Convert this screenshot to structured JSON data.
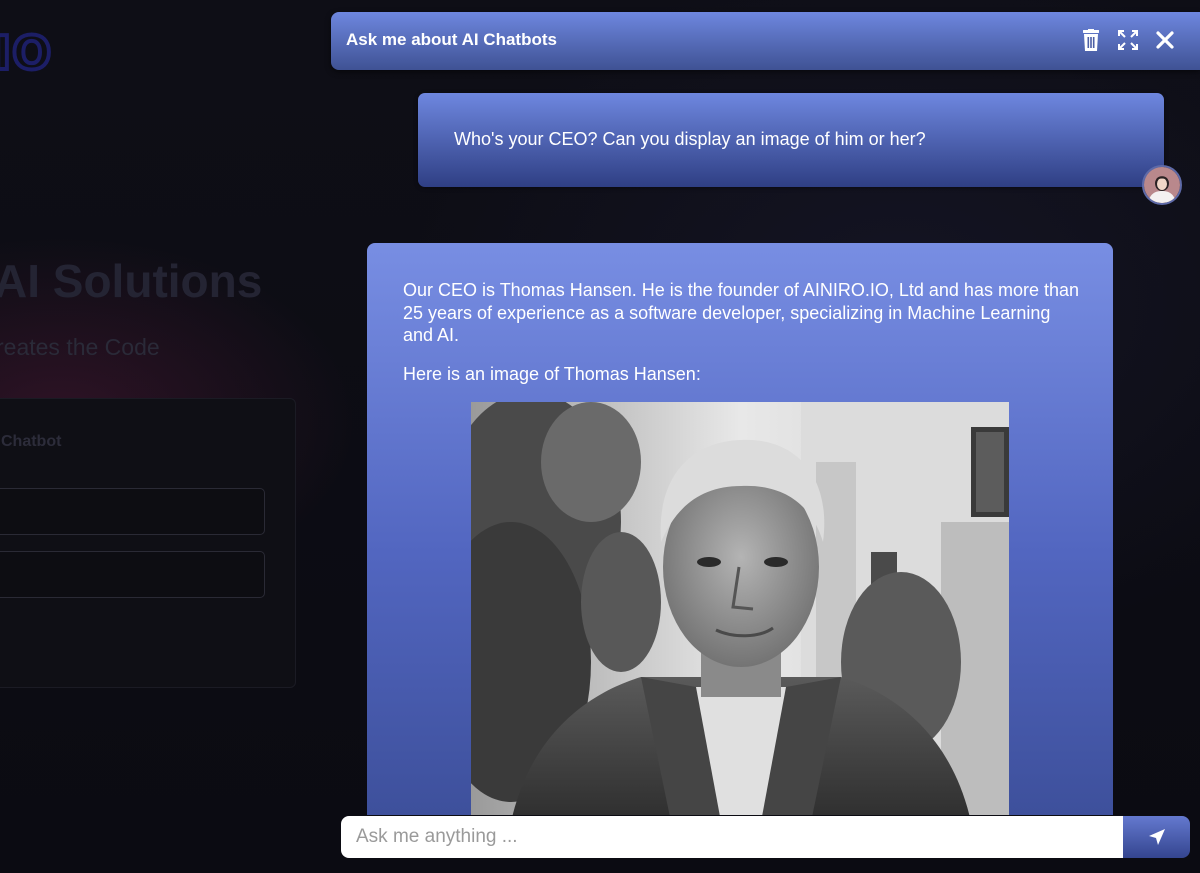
{
  "background_page": {
    "logo_text": "IO",
    "headline": "AI Solutions",
    "subline": "reates the Code",
    "card_title": "Chatbot"
  },
  "chat": {
    "title": "Ask me about AI Chatbots",
    "header_icons": [
      "trash-icon",
      "expand-icon",
      "close-icon"
    ],
    "messages": [
      {
        "role": "user",
        "text": "Who's your CEO? Can you display an image of him or her?"
      },
      {
        "role": "assistant",
        "paragraphs": [
          "Our CEO is Thomas Hansen. He is the founder of AINIRO.IO, Ltd and has more than 25 years of experience as a software developer, specializing in Machine Learning and AI.",
          "Here is an image of Thomas Hansen:"
        ],
        "image_alt": "Thomas Hansen"
      }
    ],
    "input": {
      "placeholder": "Ask me anything ...",
      "value": ""
    },
    "send_icon": "paper-plane-icon"
  },
  "colors": {
    "accent_light": "#6e87df",
    "accent_dark": "#2f3f84",
    "page_background": "#0b0b12"
  }
}
